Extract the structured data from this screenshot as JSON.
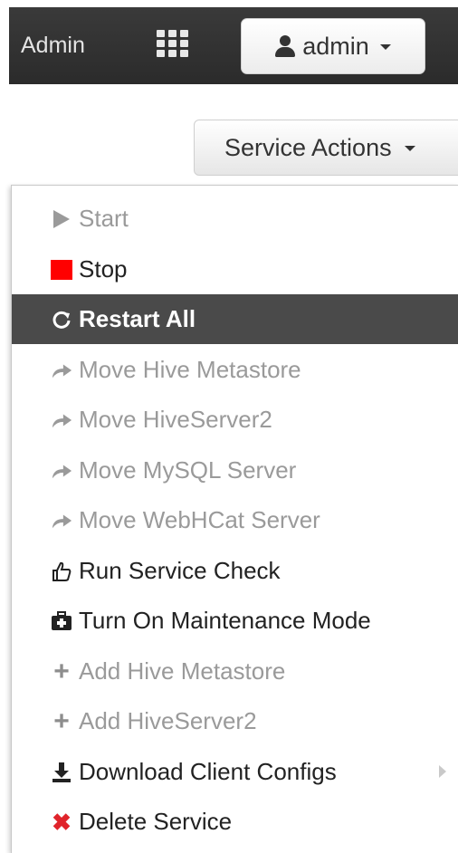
{
  "navbar": {
    "title": "Admin",
    "user_label": "admin",
    "apps_icon": "grid-icon",
    "user_icon": "user-icon"
  },
  "service_actions": {
    "label": "Service Actions"
  },
  "menu": {
    "items": [
      {
        "label": "Start",
        "icon": "play-icon",
        "state": "disabled"
      },
      {
        "label": "Stop",
        "icon": "stop-icon",
        "state": "enabled"
      },
      {
        "label": "Restart All",
        "icon": "refresh-icon",
        "state": "active"
      },
      {
        "label": "Move Hive Metastore",
        "icon": "share-icon",
        "state": "disabled"
      },
      {
        "label": "Move HiveServer2",
        "icon": "share-icon",
        "state": "disabled"
      },
      {
        "label": "Move MySQL Server",
        "icon": "share-icon",
        "state": "disabled"
      },
      {
        "label": "Move WebHCat Server",
        "icon": "share-icon",
        "state": "disabled"
      },
      {
        "label": "Run Service Check",
        "icon": "thumbs-up-icon",
        "state": "enabled"
      },
      {
        "label": "Turn On Maintenance Mode",
        "icon": "medkit-icon",
        "state": "enabled"
      },
      {
        "label": "Add Hive Metastore",
        "icon": "plus-icon",
        "state": "disabled"
      },
      {
        "label": "Add HiveServer2",
        "icon": "plus-icon",
        "state": "disabled"
      },
      {
        "label": "Download Client Configs",
        "icon": "download-icon",
        "state": "enabled"
      },
      {
        "label": "Delete Service",
        "icon": "delete-icon",
        "state": "enabled"
      }
    ]
  },
  "colors": {
    "navbar_bg": "#2f2f2f",
    "active_bg": "#4a4a4a",
    "stop_red": "#ff0000",
    "delete_red": "#e0242b",
    "disabled_text": "#9a9a9a"
  }
}
